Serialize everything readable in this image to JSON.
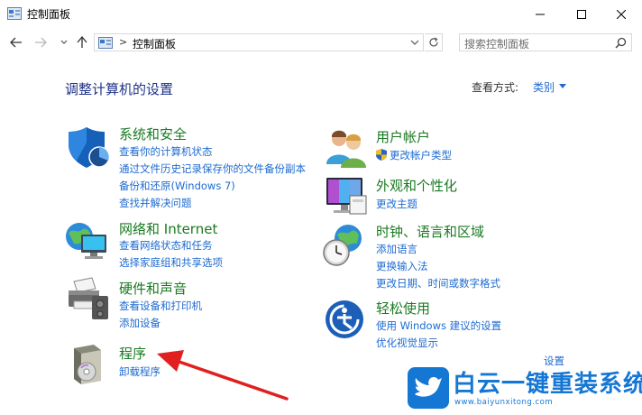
{
  "window": {
    "title": "控制面板"
  },
  "address": {
    "separator": ">",
    "path": "控制面板"
  },
  "search": {
    "placeholder": "搜索控制面板"
  },
  "heading": {
    "title": "调整计算机的设置",
    "viewby_label": "查看方式:",
    "viewby_value": "类别"
  },
  "categories_left": [
    {
      "title": "系统和安全",
      "links": [
        "查看你的计算机状态",
        "通过文件历史记录保存你的文件备份副本",
        "备份和还原(Windows 7)",
        "查找并解决问题"
      ]
    },
    {
      "title": "网络和 Internet",
      "links": [
        "查看网络状态和任务",
        "选择家庭组和共享选项"
      ]
    },
    {
      "title": "硬件和声音",
      "links": [
        "查看设备和打印机",
        "添加设备"
      ]
    },
    {
      "title": "程序",
      "links": [
        "卸载程序"
      ]
    }
  ],
  "categories_right": [
    {
      "title": "用户帐户",
      "links": [
        "更改帐户类型"
      ]
    },
    {
      "title": "外观和个性化",
      "links": [
        "更改主题"
      ]
    },
    {
      "title": "时钟、语言和区域",
      "links": [
        "添加语言",
        "更换输入法",
        "更改日期、时间或数字格式"
      ]
    },
    {
      "title": "轻松使用",
      "links": [
        "使用 Windows 建议的设置",
        "优化视觉显示"
      ]
    }
  ],
  "partial_link": "设置",
  "watermark": {
    "title": "白云一键重装系统",
    "url": "www.baiyunxitong.com"
  },
  "colors": {
    "heading": "#1e3287",
    "category_title": "#1a7a22",
    "link": "#1e6bd0",
    "arrow": "#e02020",
    "watermark": "#1577d4"
  }
}
